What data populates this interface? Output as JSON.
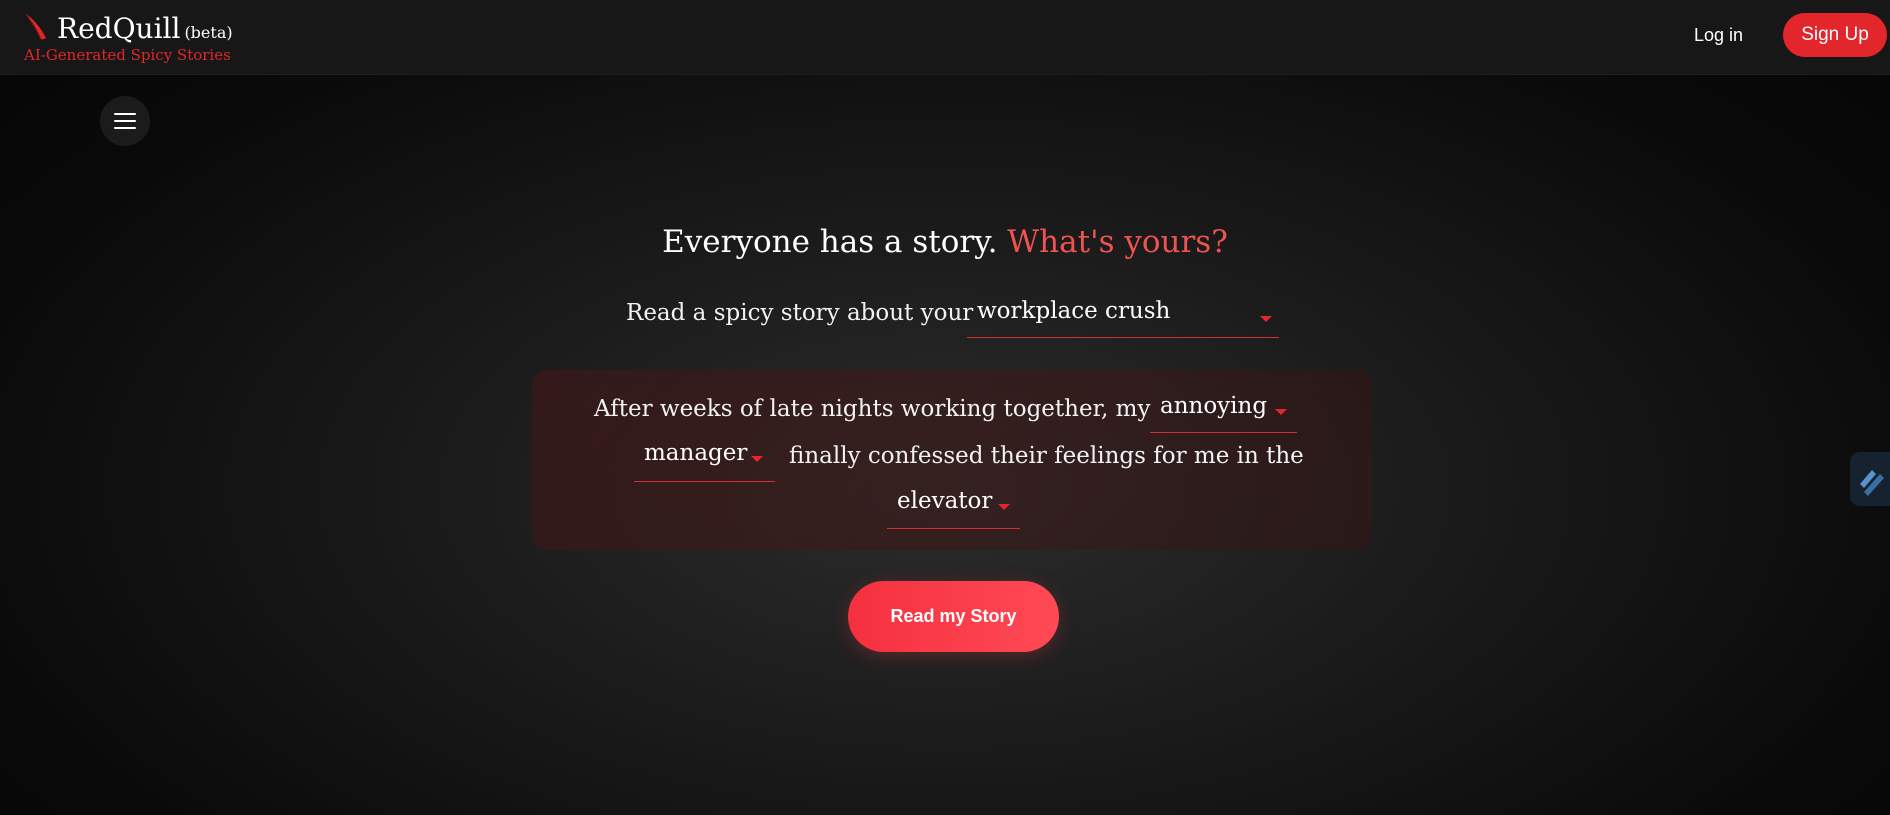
{
  "header": {
    "brand_name": "RedQuill",
    "brand_beta": "(beta)",
    "tagline": "AI-Generated Spicy Stories",
    "login_label": "Log in",
    "signup_label": "Sign Up",
    "icons": {
      "logo": "quill-icon",
      "menu": "hamburger-menu-icon",
      "side": "side-widget-icon"
    }
  },
  "hero": {
    "headline_main": "Everyone has a story.",
    "headline_accent": "What's yours?",
    "prompt_text": "Read a spicy story about your",
    "topic_selected": "workplace crush"
  },
  "story": {
    "text_1": "After weeks of late nights working together, my",
    "adjective_selected": "annoying",
    "role_selected": "manager",
    "text_2": "finally confessed their feelings for me in the",
    "location_selected": "elevator"
  },
  "cta": {
    "label": "Read my Story"
  },
  "colors": {
    "accent": "#e2262c",
    "accent_light": "#ef5350",
    "background": "#121212"
  }
}
